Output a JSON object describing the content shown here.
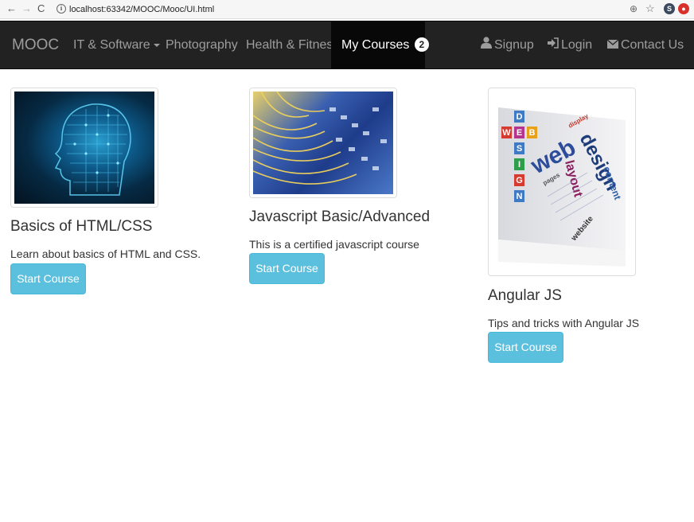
{
  "browser": {
    "url": "localhost:63342/MOOC/Mooc/UI.html",
    "ext1": "S",
    "ext2": "●"
  },
  "navbar": {
    "brand": "MOOC",
    "items": [
      {
        "label": "IT & Software"
      },
      {
        "label": "Photography"
      },
      {
        "label": "Health & Fitness"
      },
      {
        "label": "My Courses",
        "badge": "2"
      }
    ],
    "right": [
      {
        "label": "Signup",
        "icon": "user-icon"
      },
      {
        "label": "Login",
        "icon": "login-icon"
      },
      {
        "label": "Contact Us",
        "icon": "envelope-icon"
      }
    ]
  },
  "courses": [
    {
      "title": "Basics of HTML/CSS",
      "description": "Learn about basics of HTML and CSS.",
      "button": "Start Course"
    },
    {
      "title": "Javascript Basic/Advanced",
      "description": "This is a certified javascript course",
      "button": "Start Course"
    },
    {
      "title": "Angular JS",
      "description": "Tips and tricks with Angular JS",
      "button": "Start Course"
    }
  ],
  "web_design_image_text": {
    "letters_web": [
      "W",
      "E",
      "B"
    ],
    "letters_design": [
      "D",
      "E",
      "S",
      "I",
      "G",
      "N"
    ],
    "words": [
      "web",
      "design",
      "layout",
      "content",
      "website",
      "pages",
      "display"
    ]
  },
  "colors": {
    "navbar_bg": "#222222",
    "active_bg": "#080808",
    "button_info": "#5bc0de"
  }
}
